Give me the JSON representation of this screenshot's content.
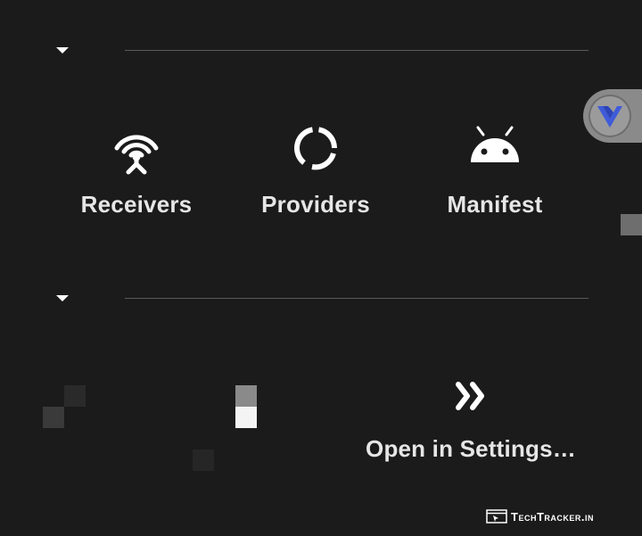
{
  "section_one": {
    "items": [
      {
        "label": "Receivers",
        "icon": "antenna-icon"
      },
      {
        "label": "Providers",
        "icon": "providers-icon"
      },
      {
        "label": "Manifest",
        "icon": "android-icon"
      }
    ]
  },
  "section_two": {
    "open_settings_label": "Open in Settings…",
    "open_settings_icon": "double-chevron-right-icon"
  },
  "watermark": {
    "text": "TechTracker.in"
  },
  "colors": {
    "background": "#1b1b1b",
    "text": "#e6e6e6",
    "divider": "#5a5a5a",
    "accent_blue": "#3f5bd9"
  }
}
